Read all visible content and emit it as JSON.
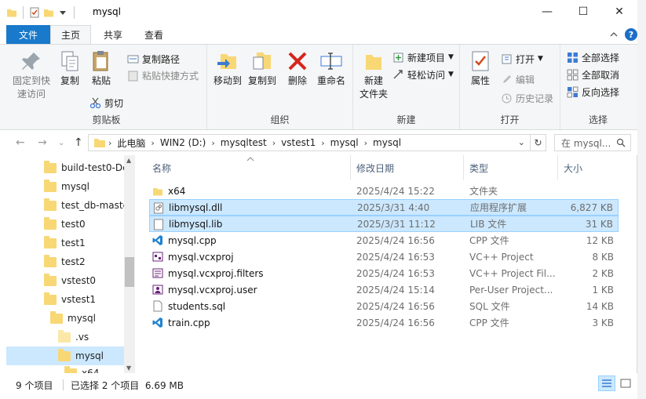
{
  "window": {
    "title": "mysql"
  },
  "title_controls": {
    "minimize": "—",
    "maximize": "☐",
    "close": "✕"
  },
  "tabs": {
    "file": "文件",
    "home": "主页",
    "share": "共享",
    "view": "查看"
  },
  "ribbon": {
    "clipboard": {
      "pin_label": "固定到快\n速访问",
      "copy_label": "复制",
      "paste_label": "粘贴",
      "copy_path": "复制路径",
      "paste_shortcut": "粘贴快捷方式",
      "cut": "剪切",
      "group": "剪贴板"
    },
    "organize": {
      "move_to": "移动到",
      "copy_to": "复制到",
      "delete": "删除",
      "rename": "重命名",
      "group": "组织"
    },
    "new": {
      "new_folder": "新建\n文件夹",
      "new_item": "新建项目",
      "easy_access": "轻松访问",
      "group": "新建"
    },
    "open": {
      "properties": "属性",
      "open": "打开",
      "edit": "编辑",
      "history": "历史记录",
      "group": "打开"
    },
    "select": {
      "select_all": "全部选择",
      "select_none": "全部取消",
      "invert": "反向选择",
      "group": "选择"
    }
  },
  "address": {
    "crumbs": [
      "此电脑",
      "WIN2 (D:)",
      "mysqltest",
      "vstest1",
      "mysql",
      "mysql"
    ],
    "search_placeholder": "在 mysql..."
  },
  "tree": [
    {
      "label": "build-test0-De",
      "indent": 0
    },
    {
      "label": "mysql",
      "indent": 0
    },
    {
      "label": "test_db-maste",
      "indent": 0
    },
    {
      "label": "test0",
      "indent": 0
    },
    {
      "label": "test1",
      "indent": 0
    },
    {
      "label": "test2",
      "indent": 0
    },
    {
      "label": "vstest0",
      "indent": 0
    },
    {
      "label": "vstest1",
      "indent": 0
    },
    {
      "label": "mysql",
      "indent": 1
    },
    {
      "label": ".vs",
      "indent": 2
    },
    {
      "label": "mysql",
      "indent": 2
    },
    {
      "label": "x64",
      "indent": 3
    }
  ],
  "columns": {
    "name": "名称",
    "date": "修改日期",
    "type": "类型",
    "size": "大小"
  },
  "files": [
    {
      "name": "x64",
      "date": "2025/4/24 15:22",
      "type": "文件夹",
      "size": "",
      "icon": "folder-icon",
      "selected": false
    },
    {
      "name": "libmysql.dll",
      "date": "2025/3/31 4:40",
      "type": "应用程序扩展",
      "size": "6,827 KB",
      "icon": "dll-file-icon",
      "selected": true
    },
    {
      "name": "libmysql.lib",
      "date": "2025/3/31 11:12",
      "type": "LIB 文件",
      "size": "31 KB",
      "icon": "lib-file-icon",
      "selected": true
    },
    {
      "name": "mysql.cpp",
      "date": "2025/4/24 16:56",
      "type": "CPP 文件",
      "size": "12 KB",
      "icon": "vscode-file-icon",
      "selected": false
    },
    {
      "name": "mysql.vcxproj",
      "date": "2025/4/24 16:53",
      "type": "VC++ Project",
      "size": "8 KB",
      "icon": "vcxproj-icon",
      "selected": false
    },
    {
      "name": "mysql.vcxproj.filters",
      "date": "2025/4/24 16:53",
      "type": "VC++ Project Fil...",
      "size": "2 KB",
      "icon": "vcxproj-filters-icon",
      "selected": false
    },
    {
      "name": "mysql.vcxproj.user",
      "date": "2025/4/24 15:14",
      "type": "Per-User Project...",
      "size": "1 KB",
      "icon": "vcxproj-user-icon",
      "selected": false
    },
    {
      "name": "students.sql",
      "date": "2025/4/24 16:56",
      "type": "SQL 文件",
      "size": "14 KB",
      "icon": "text-file-icon",
      "selected": false
    },
    {
      "name": "train.cpp",
      "date": "2025/4/24 16:56",
      "type": "CPP 文件",
      "size": "3 KB",
      "icon": "vscode-file-icon",
      "selected": false
    }
  ],
  "status": {
    "count": "9 个项目",
    "selected": "已选择 2 个项目  6.69 MB"
  },
  "colors": {
    "accent": "#1979ca",
    "selection": "#cce8ff",
    "folder": "#f8d775"
  }
}
